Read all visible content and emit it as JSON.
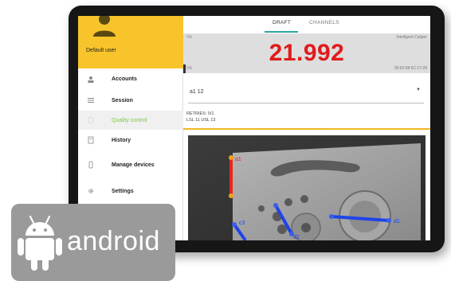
{
  "drawer": {
    "user_name": "Default user",
    "items": [
      {
        "label": "Accounts",
        "icon": "account-icon",
        "active": false
      },
      {
        "label": "Session",
        "icon": "list-icon",
        "active": false
      },
      {
        "label": "Quality control",
        "icon": "quality-icon",
        "active": true
      },
      {
        "label": "History",
        "icon": "history-icon",
        "active": false
      },
      {
        "label": "Manage devices",
        "icon": "device-icon",
        "active": false
      },
      {
        "label": "Settings",
        "icon": "gear-icon",
        "active": false
      }
    ]
  },
  "tabs": {
    "draft": "DRAFT",
    "channels": "CHANNELS",
    "active": "DRAFT"
  },
  "readout": {
    "percent_top": "0%",
    "percent_bottom": "0%",
    "device_name": "Intelligent Caliper",
    "mac_address": "00:60:98:6C:17:28",
    "value": "21.992"
  },
  "select": {
    "value": "a1 12"
  },
  "tolerance": {
    "retries": "RETRIES: 0/1",
    "limits": "LSL 11 USL 13"
  },
  "measurements": {
    "labels": [
      "a1",
      "d1",
      "d2",
      "c3"
    ]
  },
  "badge": {
    "text": "android"
  },
  "colors": {
    "accent_yellow": "#f7c52b",
    "value_red": "#e01b1b",
    "active_green": "#7ec94a",
    "tab_teal": "#2aa9a0",
    "measure_blue": "#1e44e8",
    "measure_red": "#e8261c"
  }
}
